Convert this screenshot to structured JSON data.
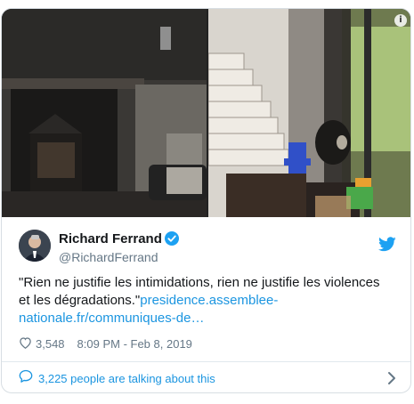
{
  "tweet": {
    "author_name": "Richard Ferrand",
    "author_handle": "@RichardFerrand",
    "text_plain": "\"Rien ne justifie les intimidations, rien ne justifie les violences et les dégradations.\"",
    "link_line1": "presidence.assemblee-",
    "link_line2": "nationale.fr/communiques-de…",
    "likes": "3,548",
    "timestamp": "8:09 PM - Feb 8, 2019",
    "conversation_label": "3,225 people are talking about this",
    "info_glyph": "i"
  },
  "icons": {
    "verified": "verified-badge-icon",
    "twitter": "twitter-bird-icon",
    "like": "heart-icon",
    "reply": "speech-bubble-icon",
    "more": "chevron-right-icon"
  },
  "colors": {
    "link": "#1b95e0",
    "secondary_text": "#657786",
    "border": "#d8dee3"
  }
}
